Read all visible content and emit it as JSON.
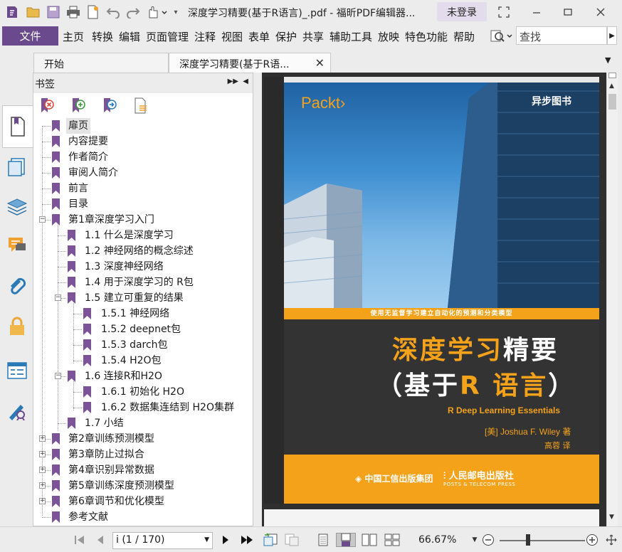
{
  "window": {
    "title": "深度学习精要(基于R语言)_.pdf - 福昕PDF编辑器...",
    "login_label": "未登录"
  },
  "menu": {
    "file": "文件",
    "items": [
      "主页",
      "转换",
      "编辑",
      "页面管理",
      "注释",
      "视图",
      "表单",
      "保护",
      "共享",
      "辅助工具",
      "放映",
      "特色功能",
      "帮助"
    ],
    "search_placeholder": "查找"
  },
  "tabs": [
    {
      "label": "开始"
    },
    {
      "label": "深度学习精要(基于R语..."
    }
  ],
  "bookmarks_panel": {
    "title": "书签",
    "items": [
      {
        "label": "扉页",
        "selected": true
      },
      {
        "label": "内容提要"
      },
      {
        "label": "作者简介"
      },
      {
        "label": "审阅人简介"
      },
      {
        "label": "前言"
      },
      {
        "label": "目录"
      },
      {
        "label": "第1章深度学习入门"
      },
      {
        "label": "1.1  什么是深度学习"
      },
      {
        "label": "1.2  神经网络的概念综述"
      },
      {
        "label": "1.3  深度神经网络"
      },
      {
        "label": "1.4  用于深度学习的 R包"
      },
      {
        "label": "1.5  建立可重复的结果"
      },
      {
        "label": "1.5.1  神经网络"
      },
      {
        "label": "1.5.2  deepnet包"
      },
      {
        "label": "1.5.3  darch包"
      },
      {
        "label": "1.5.4  H2O包"
      },
      {
        "label": "1.6 连接R和H2O"
      },
      {
        "label": "1.6.1  初始化 H2O"
      },
      {
        "label": "1.6.2  数据集连结到 H2O集群"
      },
      {
        "label": "1.7 小结"
      },
      {
        "label": "第2章训练预测模型"
      },
      {
        "label": "第3章防止过拟合"
      },
      {
        "label": "第4章识别异常数据"
      },
      {
        "label": "第5章训练深度预测模型"
      },
      {
        "label": "第6章调节和优化模型"
      },
      {
        "label": "参考文献"
      }
    ]
  },
  "cover": {
    "publisher_logo": "Packt›",
    "imprint": "异步图书",
    "tagline": "使用无监督学习建立自动化的预测和分类模型",
    "title_orange": "深度学习",
    "title_white": "精要",
    "subtitle_open": "（基于",
    "subtitle_r": "R 语言",
    "subtitle_close": "）",
    "english_title": "R Deep Learning Essentials",
    "author": "[美] Joshua F. Wiley 著",
    "translator": "高蓉 译",
    "publisher_1": "中国工信出版集团",
    "publisher_2": "人民邮电出版社",
    "publisher_2_en": "POSTS & TELECOM PRESS"
  },
  "status": {
    "page_indicator": "i (1 / 170)",
    "zoom": "66.67%"
  },
  "colors": {
    "accent_purple": "#6a4a8c",
    "bookmark_flag": "#7b5396",
    "cover_orange": "#f5a21b"
  }
}
